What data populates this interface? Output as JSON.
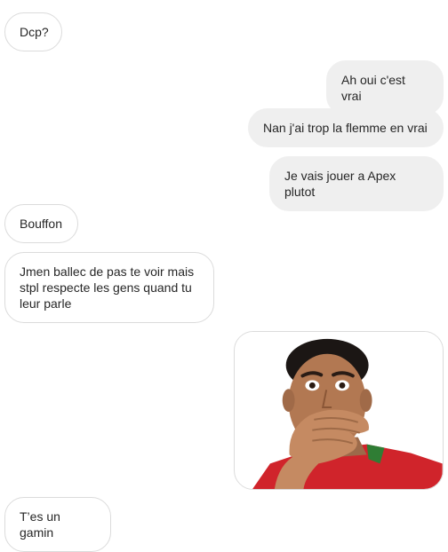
{
  "messages": [
    {
      "side": "received",
      "text": "Dcp?"
    },
    {
      "side": "sent",
      "text": "Ah oui c'est vrai"
    },
    {
      "side": "sent",
      "text": "Nan j'ai trop la flemme en vrai"
    },
    {
      "side": "sent",
      "text": "Je vais jouer a Apex plutot"
    },
    {
      "side": "received",
      "text": "Bouffon"
    },
    {
      "side": "received",
      "text": "Jmen ballec de pas te voir mais stpl respecte les gens quand tu leur parle"
    },
    {
      "side": "sent",
      "type": "image"
    },
    {
      "side": "received",
      "text": "T’es un gamin"
    }
  ]
}
